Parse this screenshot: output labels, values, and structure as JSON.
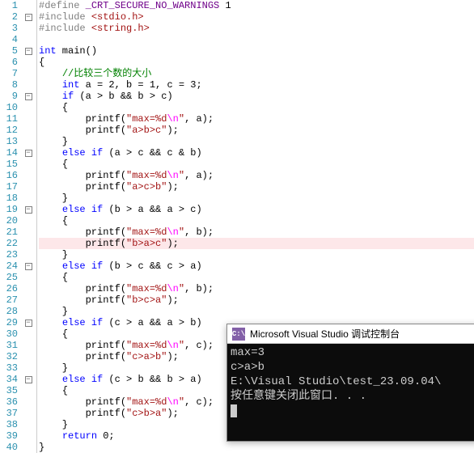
{
  "lines": [
    {
      "n": 1,
      "fold": "",
      "html": "<span class='mac'>#define</span> <span class='def'>_CRT_SECURE_NO_WARNINGS</span> 1"
    },
    {
      "n": 2,
      "fold": "⊟",
      "html": "<span class='mac'>#include</span> <span class='inc'>&lt;stdio.h&gt;</span>"
    },
    {
      "n": 3,
      "fold": "",
      "html": "<span class='mac'>#include</span> <span class='inc'>&lt;string.h&gt;</span>"
    },
    {
      "n": 4,
      "fold": "",
      "html": ""
    },
    {
      "n": 5,
      "fold": "⊟",
      "html": "<span class='kw'>int</span> main()"
    },
    {
      "n": 6,
      "fold": "",
      "html": "{"
    },
    {
      "n": 7,
      "fold": "",
      "html": "    <span class='cmt'>//比较三个数的大小</span>"
    },
    {
      "n": 8,
      "fold": "",
      "html": "    <span class='kw'>int</span> a = 2, b = 1, c = 3;"
    },
    {
      "n": 9,
      "fold": "⊟",
      "html": "    <span class='kw'>if</span> (a &gt; b &amp;&amp; b &gt; c)"
    },
    {
      "n": 10,
      "fold": "",
      "html": "    {"
    },
    {
      "n": 11,
      "fold": "",
      "html": "        printf(<span class='str'>\"max=%d<span class='esc'>\\n</span>\"</span>, a);"
    },
    {
      "n": 12,
      "fold": "",
      "html": "        printf(<span class='str'>\"a&gt;b&gt;c\"</span>);"
    },
    {
      "n": 13,
      "fold": "",
      "html": "    }"
    },
    {
      "n": 14,
      "fold": "⊟",
      "html": "    <span class='kw'>else</span> <span class='kw'>if</span> (a &gt; c &amp;&amp; c &amp; b)"
    },
    {
      "n": 15,
      "fold": "",
      "html": "    {"
    },
    {
      "n": 16,
      "fold": "",
      "html": "        printf(<span class='str'>\"max=%d<span class='esc'>\\n</span>\"</span>, a);"
    },
    {
      "n": 17,
      "fold": "",
      "html": "        printf(<span class='str'>\"a&gt;c&gt;b\"</span>);"
    },
    {
      "n": 18,
      "fold": "",
      "html": "    }"
    },
    {
      "n": 19,
      "fold": "⊟",
      "html": "    <span class='kw'>else</span> <span class='kw'>if</span> (b &gt; a &amp;&amp; a &gt; c)"
    },
    {
      "n": 20,
      "fold": "",
      "html": "    {"
    },
    {
      "n": 21,
      "fold": "",
      "html": "        printf(<span class='str'>\"max=%d<span class='esc'>\\n</span>\"</span>, b);"
    },
    {
      "n": 22,
      "fold": "",
      "html": "        printf(<span class='str'>\"b&gt;a&gt;c\"</span>);",
      "hl": true
    },
    {
      "n": 23,
      "fold": "",
      "html": "    }"
    },
    {
      "n": 24,
      "fold": "⊟",
      "html": "    <span class='kw'>else</span> <span class='kw'>if</span> (b &gt; c &amp;&amp; c &gt; a)"
    },
    {
      "n": 25,
      "fold": "",
      "html": "    {"
    },
    {
      "n": 26,
      "fold": "",
      "html": "        printf(<span class='str'>\"max=%d<span class='esc'>\\n</span>\"</span>, b);"
    },
    {
      "n": 27,
      "fold": "",
      "html": "        printf(<span class='str'>\"b&gt;c&gt;a\"</span>);"
    },
    {
      "n": 28,
      "fold": "",
      "html": "    }"
    },
    {
      "n": 29,
      "fold": "⊟",
      "html": "    <span class='kw'>else</span> <span class='kw'>if</span> (c &gt; a &amp;&amp; a &gt; b)"
    },
    {
      "n": 30,
      "fold": "",
      "html": "    {"
    },
    {
      "n": 31,
      "fold": "",
      "html": "        printf(<span class='str'>\"max=%d<span class='esc'>\\n</span>\"</span>, c);"
    },
    {
      "n": 32,
      "fold": "",
      "html": "        printf(<span class='str'>\"c&gt;a&gt;b\"</span>);"
    },
    {
      "n": 33,
      "fold": "",
      "html": "    }"
    },
    {
      "n": 34,
      "fold": "⊟",
      "html": "    <span class='kw'>else</span> <span class='kw'>if</span> (c &gt; b &amp;&amp; b &gt; a)"
    },
    {
      "n": 35,
      "fold": "",
      "html": "    {"
    },
    {
      "n": 36,
      "fold": "",
      "html": "        printf(<span class='str'>\"max=%d<span class='esc'>\\n</span>\"</span>, c);"
    },
    {
      "n": 37,
      "fold": "",
      "html": "        printf(<span class='str'>\"c&gt;b&gt;a\"</span>);"
    },
    {
      "n": 38,
      "fold": "",
      "html": "    }"
    },
    {
      "n": 39,
      "fold": "",
      "html": "    <span class='kw'>return</span> 0;"
    },
    {
      "n": 40,
      "fold": "",
      "html": "}"
    }
  ],
  "console": {
    "icon_text": "C:\\",
    "title": "Microsoft Visual Studio 调试控制台",
    "output": [
      "max=3",
      "c>a>b",
      "E:\\Visual Studio\\test_23.09.04\\",
      "按任意键关闭此窗口. . ."
    ]
  }
}
